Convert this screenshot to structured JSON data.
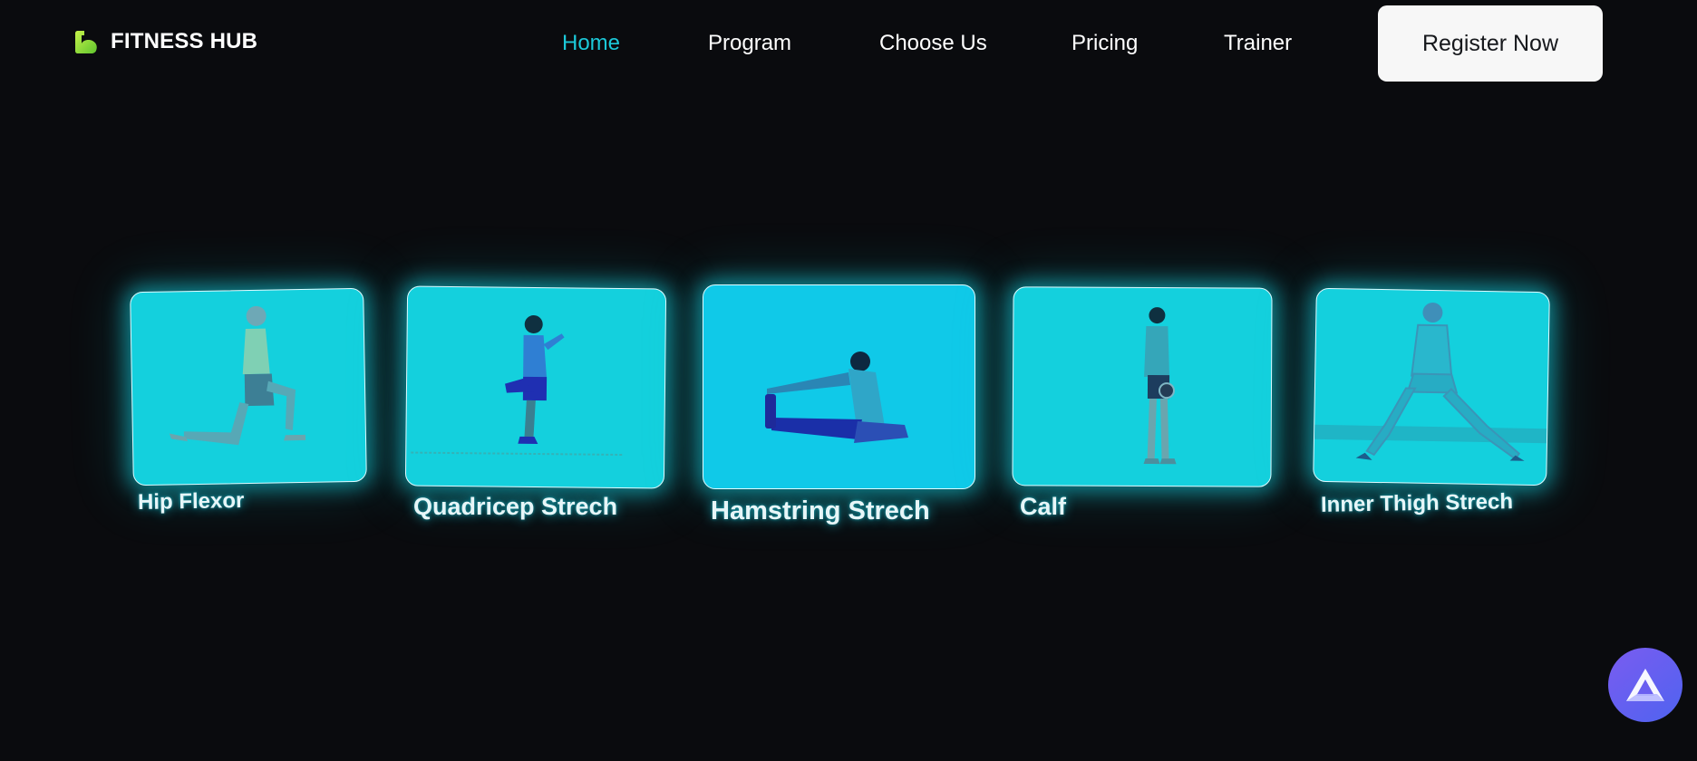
{
  "brand": {
    "name": "FITNESS HUB",
    "icon": "flexed-arm-icon"
  },
  "nav": {
    "items": [
      {
        "label": "Home",
        "active": true
      },
      {
        "label": "Program",
        "active": false
      },
      {
        "label": "Choose Us",
        "active": false
      },
      {
        "label": "Pricing",
        "active": false
      },
      {
        "label": "Trainer",
        "active": false
      }
    ],
    "cta_label": "Register Now"
  },
  "colors": {
    "background": "#0a0b0e",
    "accent": "#1cc8d8",
    "card": "#14d0dd",
    "button": "#f7f7f7"
  },
  "stretches": [
    {
      "label": "Hip Flexor",
      "icon": "kneeling-lunge-figure"
    },
    {
      "label": "Quadricep Strech",
      "icon": "standing-quad-stretch-figure"
    },
    {
      "label": "Hamstring Strech",
      "icon": "seated-hamstring-stretch-figure"
    },
    {
      "label": "Calf",
      "icon": "standing-calf-figure"
    },
    {
      "label": "Inner Thigh Strech",
      "icon": "side-lunge-figure"
    }
  ],
  "widget": {
    "icon": "assistant-logo-icon"
  }
}
